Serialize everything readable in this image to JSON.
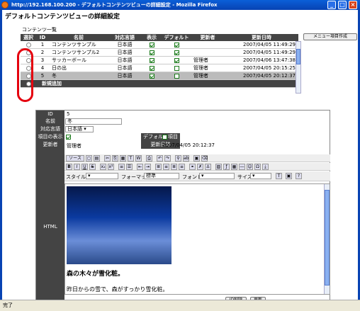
{
  "window": {
    "title": "http://192.168.100.200 - デフォルトコンテンツビューの詳細設定 - Mozilla Firefox"
  },
  "page": {
    "title": "デフォルトコンテンツビューの詳細設定",
    "section": "コンテンツ一覧",
    "menu_button": "メニュー項目作成"
  },
  "table": {
    "headers": [
      "選択",
      "ID",
      "名前",
      "対応言語",
      "表示",
      "デフォルト",
      "更新者",
      "更新日時"
    ],
    "rows": [
      {
        "id": "1",
        "name": "コンテンツサンプル",
        "lang": "日本語",
        "show": true,
        "def": true,
        "updater": "",
        "date": "2007/04/05 11:49:29"
      },
      {
        "id": "2",
        "name": "コンテンツサンプル2",
        "lang": "日本語",
        "show": true,
        "def": true,
        "updater": "",
        "date": "2007/04/05 11:49:29"
      },
      {
        "id": "3",
        "name": "サッカーボール",
        "lang": "日本語",
        "show": true,
        "def": true,
        "updater": "管理者",
        "date": "2007/04/06 13:47:38"
      },
      {
        "id": "4",
        "name": "日の出",
        "lang": "日本語",
        "show": true,
        "def": false,
        "updater": "管理者",
        "date": "2007/04/05 20:15:25"
      },
      {
        "id": "5",
        "name": "冬",
        "lang": "日本語",
        "show": true,
        "def": false,
        "updater": "管理者",
        "date": "2007/04/05 20:12:37"
      }
    ],
    "add_label": "新規追加"
  },
  "detail": {
    "labels": {
      "id": "ID",
      "name": "名前",
      "lang": "対応言語",
      "show": "項目の表示",
      "updater": "更新者",
      "default": "デフォルト項目",
      "date": "更新日時",
      "html": "HTML"
    },
    "id": "5",
    "name": "冬",
    "lang": "日本語",
    "updater": "管理者",
    "date": "2007/04/05 20:12:37"
  },
  "toolbar": {
    "source": "ソース",
    "style": "スタイル",
    "format": "フォーマット",
    "format_val": "標準",
    "font": "フォント",
    "size": "サイズ"
  },
  "editor": {
    "heading": "森の木々が雪化粧。",
    "body": "昨日からの雪で、森がすっかり雪化粧。"
  },
  "buttons": {
    "delete": "ID削除",
    "update": "更新"
  },
  "status": {
    "text": "完了"
  }
}
